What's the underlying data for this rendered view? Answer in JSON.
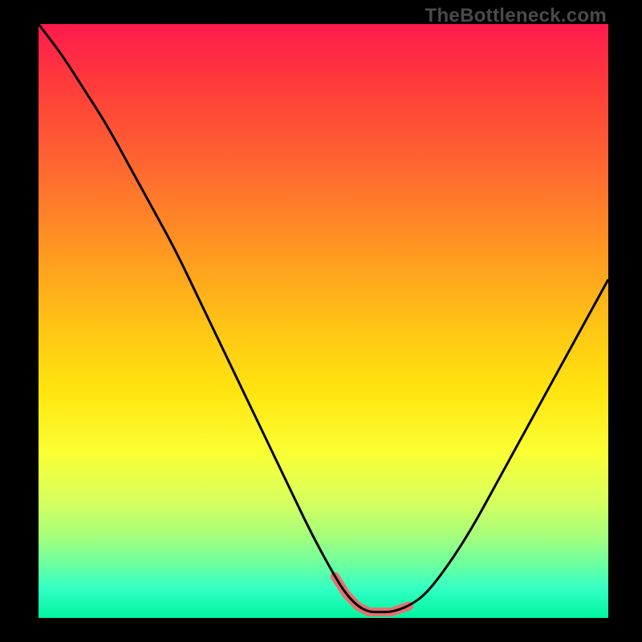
{
  "watermark": "TheBottleneck.com",
  "colors": {
    "accent": "#e8706e",
    "curve": "#000000",
    "gradient_top": "#ff1a4d",
    "gradient_bottom": "#00f5a0",
    "frame": "#000000"
  },
  "chart_data": {
    "type": "line",
    "title": "",
    "xlabel": "",
    "ylabel": "",
    "xlim": [
      0,
      100
    ],
    "ylim": [
      0,
      100
    ],
    "grid": false,
    "legend": "none",
    "series": [
      {
        "name": "curve",
        "x": [
          0,
          4,
          8,
          12,
          16,
          20,
          24,
          28,
          32,
          36,
          40,
          44,
          48,
          52,
          54,
          56,
          58,
          60,
          62,
          65,
          68,
          72,
          76,
          80,
          84,
          88,
          92,
          96,
          100
        ],
        "values": [
          100,
          95,
          89,
          83,
          76,
          69,
          62,
          54,
          46,
          38,
          30,
          22,
          14,
          7,
          4,
          2,
          1,
          1,
          1,
          2,
          4,
          9,
          15,
          22,
          29,
          36,
          43,
          50,
          57
        ]
      }
    ],
    "annotations": [
      {
        "name": "valley-highlight",
        "x_range": [
          52,
          65
        ],
        "y": 1,
        "color": "#e8706e"
      }
    ]
  }
}
